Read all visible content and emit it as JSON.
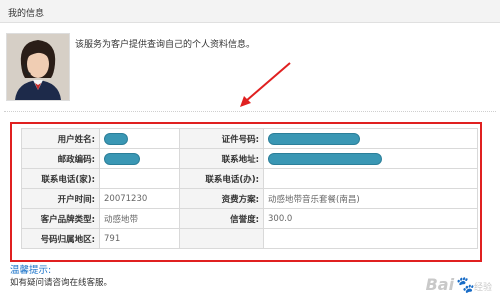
{
  "header": {
    "title": "我的信息"
  },
  "intro": {
    "text": "该服务为客户提供查询自己的个人资料信息。"
  },
  "colors": {
    "accent_red": "#e02020",
    "mask_blue": "#3a97b4",
    "tip_blue": "#1a73c9"
  },
  "info_table": {
    "rows": [
      {
        "label1": "用户姓名:",
        "value1": "",
        "label2": "证件号码:",
        "value2": ""
      },
      {
        "label1": "邮政编码:",
        "value1": "",
        "label2": "联系地址:",
        "value2": ""
      },
      {
        "label1": "联系电话(家):",
        "value1": "",
        "label2": "联系电话(办):",
        "value2": ""
      },
      {
        "label1": "开户时间:",
        "value1": "20071230",
        "label2": "资费方案:",
        "value2": "动感地带音乐套餐(南昌)"
      },
      {
        "label1": "客户品牌类型:",
        "value1": "动感地带",
        "label2": "信誉度:",
        "value2": "300.0"
      },
      {
        "label1": "号码归属地区:",
        "value1": "791",
        "label2": "",
        "value2": ""
      }
    ]
  },
  "tip": {
    "title": "温馨提示:",
    "body": "如有疑问请咨询在线客服。"
  },
  "watermark": {
    "brand": "Bai",
    "suffix": "经验"
  }
}
